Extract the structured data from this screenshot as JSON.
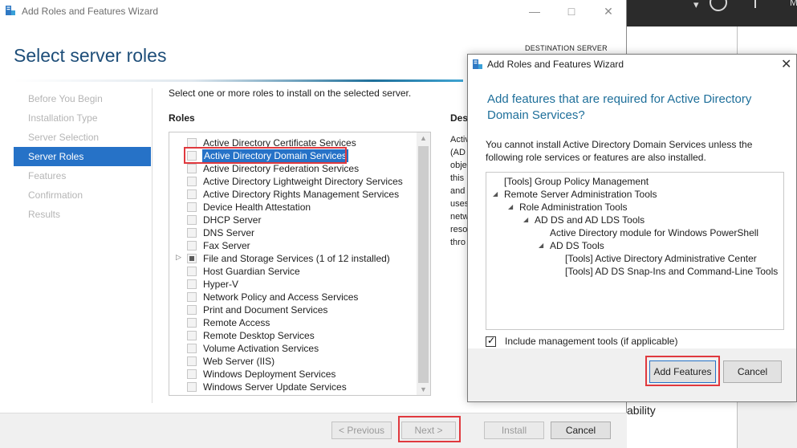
{
  "wizard": {
    "window_title": "Add Roles and Features Wizard",
    "page_title": "Select server roles",
    "destination_label": "DESTINATION SERVER",
    "instruction": "Select one or more roles to install on the selected server.",
    "roles_heading": "Roles",
    "description_heading": "Desc",
    "description_fragments": [
      "Activ",
      "(AD",
      "obje",
      "this",
      "and",
      "uses",
      "netw",
      "reso",
      "thro"
    ],
    "nav": [
      {
        "label": "Before You Begin",
        "state": "disabled"
      },
      {
        "label": "Installation Type",
        "state": "disabled"
      },
      {
        "label": "Server Selection",
        "state": "disabled"
      },
      {
        "label": "Server Roles",
        "state": "active"
      },
      {
        "label": "Features",
        "state": "disabled"
      },
      {
        "label": "Confirmation",
        "state": "disabled"
      },
      {
        "label": "Results",
        "state": "disabled"
      }
    ],
    "roles": [
      {
        "label": "Active Directory Certificate Services"
      },
      {
        "label": "Active Directory Domain Services",
        "selected": true
      },
      {
        "label": "Active Directory Federation Services"
      },
      {
        "label": "Active Directory Lightweight Directory Services"
      },
      {
        "label": "Active Directory Rights Management Services"
      },
      {
        "label": "Device Health Attestation"
      },
      {
        "label": "DHCP Server"
      },
      {
        "label": "DNS Server"
      },
      {
        "label": "Fax Server"
      },
      {
        "label": "File and Storage Services (1 of 12 installed)",
        "partial": true,
        "expandable": true
      },
      {
        "label": "Host Guardian Service"
      },
      {
        "label": "Hyper-V"
      },
      {
        "label": "Network Policy and Access Services"
      },
      {
        "label": "Print and Document Services"
      },
      {
        "label": "Remote Access"
      },
      {
        "label": "Remote Desktop Services"
      },
      {
        "label": "Volume Activation Services"
      },
      {
        "label": "Web Server (IIS)"
      },
      {
        "label": "Windows Deployment Services"
      },
      {
        "label": "Windows Server Update Services"
      }
    ],
    "buttons": {
      "previous": "< Previous",
      "next": "Next >",
      "install": "Install",
      "cancel": "Cancel"
    }
  },
  "background": {
    "partial_text": "ability",
    "header_letter": "M"
  },
  "dialog": {
    "title": "Add Roles and Features Wizard",
    "heading": "Add features that are required for Active Directory Domain Services?",
    "paragraph": "You cannot install Active Directory Domain Services unless the following role services or features are also installed.",
    "tree": [
      {
        "label": "[Tools] Group Policy Management",
        "level": 0,
        "expanded": null
      },
      {
        "label": "Remote Server Administration Tools",
        "level": 0,
        "expanded": true
      },
      {
        "label": "Role Administration Tools",
        "level": 1,
        "expanded": true
      },
      {
        "label": "AD DS and AD LDS Tools",
        "level": 2,
        "expanded": true
      },
      {
        "label": "Active Directory module for Windows PowerShell",
        "level": 3,
        "expanded": null
      },
      {
        "label": "AD DS Tools",
        "level": 3,
        "expanded": true
      },
      {
        "label": "[Tools] Active Directory Administrative Center",
        "level": 4,
        "expanded": null
      },
      {
        "label": "[Tools] AD DS Snap-Ins and Command-Line Tools",
        "level": 4,
        "expanded": null
      }
    ],
    "include_tools_label": "Include management tools (if applicable)",
    "include_tools_checked": true,
    "buttons": {
      "add_features": "Add Features",
      "cancel": "Cancel"
    }
  },
  "colors": {
    "accent": "#2672c7",
    "title_blue": "#1e4e79",
    "highlight_red": "#e0393e"
  }
}
